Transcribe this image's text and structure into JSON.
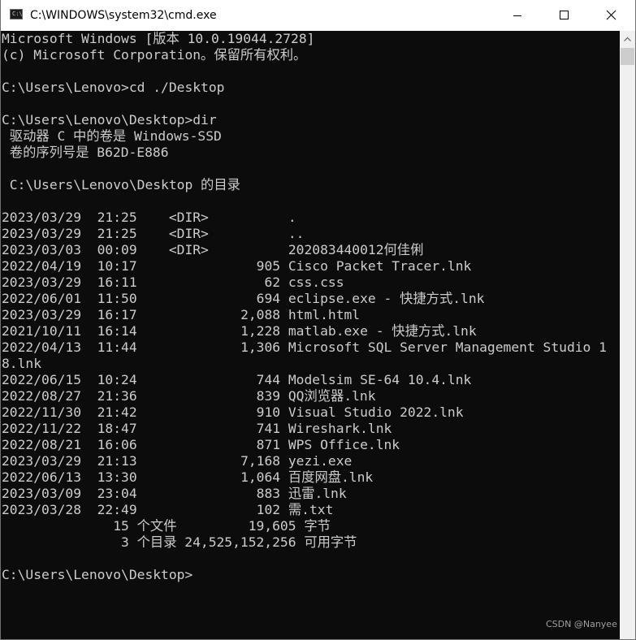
{
  "window": {
    "title": "C:\\WINDOWS\\system32\\cmd.exe",
    "icon": "cmd-console-icon",
    "controls": {
      "minimize_icon": "minimize-icon",
      "maximize_icon": "maximize-icon",
      "close_icon": "close-icon"
    }
  },
  "console": {
    "background": "#0c0c0c",
    "foreground": "#cccccc",
    "lines": [
      "Microsoft Windows [版本 10.0.19044.2728]",
      "(c) Microsoft Corporation。保留所有权利。",
      "",
      "C:\\Users\\Lenovo>cd ./Desktop",
      "",
      "C:\\Users\\Lenovo\\Desktop>dir",
      " 驱动器 C 中的卷是 Windows-SSD",
      " 卷的序列号是 B62D-E886",
      "",
      " C:\\Users\\Lenovo\\Desktop 的目录",
      "",
      "2023/03/29  21:25    <DIR>          .",
      "2023/03/29  21:25    <DIR>          ..",
      "2023/03/03  00:09    <DIR>          202083440012何佳俐",
      "2022/04/19  10:17               905 Cisco Packet Tracer.lnk",
      "2023/03/29  16:11                62 css.css",
      "2022/06/01  11:50               694 eclipse.exe - 快捷方式.lnk",
      "2023/03/29  16:17             2,088 html.html",
      "2021/10/11  16:14             1,228 matlab.exe - 快捷方式.lnk",
      "2022/04/13  11:44             1,306 Microsoft SQL Server Management Studio 1",
      "8.lnk",
      "2022/06/15  10:24               744 Modelsim SE-64 10.4.lnk",
      "2022/08/27  21:36               839 QQ浏览器.lnk",
      "2022/11/30  21:42               910 Visual Studio 2022.lnk",
      "2022/11/22  18:47               741 Wireshark.lnk",
      "2022/08/21  16:06               871 WPS Office.lnk",
      "2023/03/29  21:13             7,168 yezi.exe",
      "2022/06/13  13:30             1,064 百度网盘.lnk",
      "2023/03/09  23:04               883 迅雷.lnk",
      "2023/03/28  22:49               102 需.txt",
      "              15 个文件         19,605 字节",
      "               3 个目录 24,525,152,256 可用字节",
      "",
      "C:\\Users\\Lenovo\\Desktop>"
    ]
  },
  "scrollbar": {
    "up_icon": "scroll-up-arrow-icon"
  },
  "watermark": "CSDN @Nanyee"
}
